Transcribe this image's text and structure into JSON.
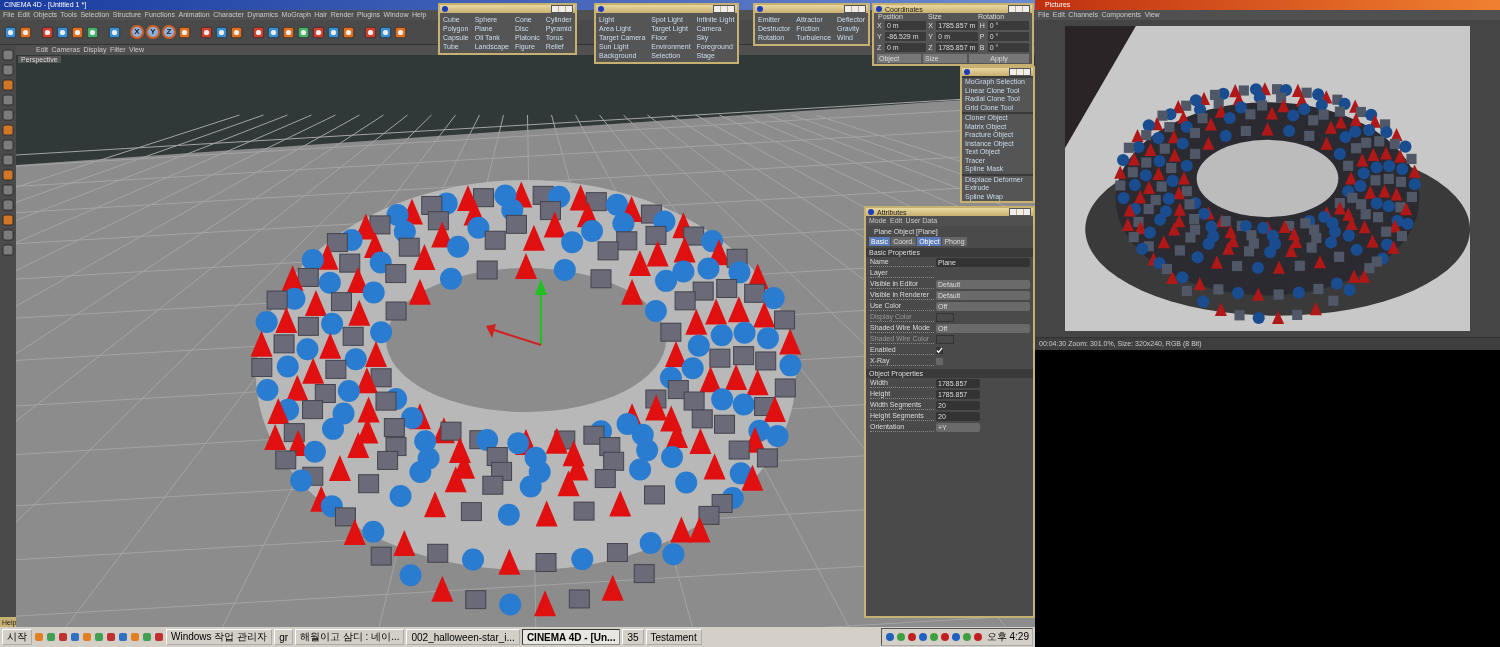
{
  "main_window": {
    "title": "CINEMA 4D - [Untitled 1 *]"
  },
  "menu_bar": [
    "File",
    "Edit",
    "Objects",
    "Tools",
    "Selection",
    "Structure",
    "Functions",
    "Animation",
    "Character",
    "Dynamics",
    "MoGraph",
    "Hair",
    "Render",
    "Plugins",
    "Window",
    "Help"
  ],
  "toolbar": [
    {
      "kind": "tool"
    },
    {
      "kind": "tool"
    },
    {
      "kind": "gap"
    },
    {
      "kind": "tool"
    },
    {
      "kind": "tool"
    },
    {
      "kind": "tool"
    },
    {
      "kind": "tool"
    },
    {
      "kind": "gap"
    },
    {
      "kind": "tool"
    },
    {
      "kind": "gap"
    },
    {
      "kind": "axis",
      "label": "X"
    },
    {
      "kind": "axis",
      "label": "Y"
    },
    {
      "kind": "axis",
      "label": "Z"
    },
    {
      "kind": "tool"
    },
    {
      "kind": "gap"
    },
    {
      "kind": "tool"
    },
    {
      "kind": "tool"
    },
    {
      "kind": "tool"
    },
    {
      "kind": "gap"
    },
    {
      "kind": "tool"
    },
    {
      "kind": "tool"
    },
    {
      "kind": "tool"
    },
    {
      "kind": "tool"
    },
    {
      "kind": "tool"
    },
    {
      "kind": "tool"
    },
    {
      "kind": "tool"
    },
    {
      "kind": "gap"
    },
    {
      "kind": "tool"
    },
    {
      "kind": "tool"
    },
    {
      "kind": "tool"
    }
  ],
  "viewport": {
    "menu": [
      "Edit",
      "Cameras",
      "Display",
      "Filter",
      "View"
    ],
    "label": "Perspective"
  },
  "primitives_palette": {
    "items": [
      "Cube",
      "Sphere",
      "Cone",
      "Cylinder",
      "Polygon",
      "Plane",
      "Disc",
      "Pyramid",
      "Capsule",
      "Oil Tank",
      "Platonic",
      "Torus",
      "Tube",
      "Landscape",
      "Figure",
      "Relief"
    ]
  },
  "lights_palette": {
    "items": [
      "Light",
      "Spot Light",
      "Infinite Light",
      "Area Light",
      "Target Light",
      "Camera",
      "Target Camera",
      "Floor",
      "Sky",
      "Sun Light",
      "Environment",
      "Foreground",
      "Background",
      "Selection",
      "Stage"
    ]
  },
  "particles_palette": {
    "items": [
      "Emitter",
      "Attractor",
      "Deflector",
      "Destructor",
      "Friction",
      "Gravity",
      "Rotation",
      "Turbulence",
      "Wind"
    ]
  },
  "coordinates": {
    "title": "Coordinates",
    "headers": [
      "Position",
      "Size",
      "Rotation"
    ],
    "rows": [
      {
        "axis": "X",
        "position": "0 m",
        "size_axis": "X",
        "size": "1785.857 m",
        "rot_axis": "H",
        "rotation": "0 °"
      },
      {
        "axis": "Y",
        "position": "-86.529 m",
        "size_axis": "Y",
        "size": "0 m",
        "rot_axis": "P",
        "rotation": "0 °"
      },
      {
        "axis": "Z",
        "position": "0 m",
        "size_axis": "Z",
        "size": "1785.857 m",
        "rot_axis": "B",
        "rotation": "0 °"
      }
    ],
    "dropdowns": [
      "Object",
      "Size"
    ],
    "apply": "Apply"
  },
  "mograph_palette": {
    "groups": [
      [
        "MoGraph Selection",
        "Linear Clone Tool",
        "Radial Clone Tool",
        "Grid Clone Tool"
      ],
      [
        "Cloner Object",
        "Matrix Object",
        "Fracture Object",
        "Instance Object",
        "Text Object",
        "Tracer",
        "Spline Mask"
      ],
      [
        "Displace Deformer",
        "Extrude",
        "Spline Wrap"
      ]
    ]
  },
  "attributes": {
    "title": "Attributes",
    "menu": [
      "Mode",
      "Edit",
      "User Data"
    ],
    "object": "Plane Object [Plane]",
    "tabs": [
      {
        "label": "Basic",
        "selected": true
      },
      {
        "label": "Coord.",
        "selected": false
      },
      {
        "label": "Object",
        "selected": true
      },
      {
        "label": "Phong",
        "selected": false
      }
    ],
    "sections": [
      {
        "title": "Basic Properties",
        "rows": [
          {
            "kind": "text",
            "label": "Name",
            "value": "Plane",
            "disabled": false
          },
          {
            "kind": "text",
            "label": "Layer",
            "disabled": false
          },
          {
            "kind": "select",
            "label": "Visible in Editor",
            "value": "Default",
            "disabled": false
          },
          {
            "kind": "select",
            "label": "Visible in Renderer",
            "value": "Default",
            "disabled": false
          },
          {
            "kind": "select",
            "label": "Use Color",
            "value": "Off",
            "disabled": false
          },
          {
            "kind": "color",
            "label": "Display Color",
            "disabled": true
          },
          {
            "kind": "select",
            "label": "Shaded Wire Mode",
            "value": "Off",
            "disabled": false
          },
          {
            "kind": "color",
            "label": "Shaded Wire Color",
            "disabled": true
          },
          {
            "kind": "check",
            "label": "Enabled",
            "checked": true,
            "disabled": false
          },
          {
            "kind": "check",
            "label": "X-Ray",
            "checked": false,
            "disabled": false
          }
        ]
      },
      {
        "title": "Object Properties",
        "rows": [
          {
            "kind": "number",
            "label": "Width",
            "value": "1785.857",
            "disabled": false
          },
          {
            "kind": "number",
            "label": "Height",
            "value": "1785.857",
            "disabled": false
          },
          {
            "kind": "number",
            "label": "Width Segments",
            "value": "20",
            "disabled": false
          },
          {
            "kind": "number",
            "label": "Height Segments",
            "value": "20",
            "disabled": false
          },
          {
            "kind": "short_select",
            "label": "Orientation",
            "value": "+Y",
            "disabled": false
          }
        ]
      }
    ]
  },
  "picture_viewer": {
    "title": "Pictures",
    "menu": [
      "File",
      "Edit",
      "Channels",
      "Components",
      "View"
    ],
    "status": "00:04:30 Zoom: 301.0%, Size: 320x240, RGB (8 Bit)"
  },
  "help_window": {
    "title": "Help"
  },
  "taskbar": {
    "start": "시작",
    "tasks": [
      {
        "label": "Windows 작업 관리자",
        "selected": false
      },
      {
        "label": "gr",
        "selected": false
      },
      {
        "label": "해월이고 삼디 : 네이...",
        "selected": false
      },
      {
        "label": "002_halloween-star_i...",
        "selected": false
      },
      {
        "label": "CINEMA 4D - [Un...",
        "selected": true
      },
      {
        "label": "35",
        "selected": false
      },
      {
        "label": "Testament",
        "selected": false
      }
    ],
    "clock": "오후 4:29"
  }
}
